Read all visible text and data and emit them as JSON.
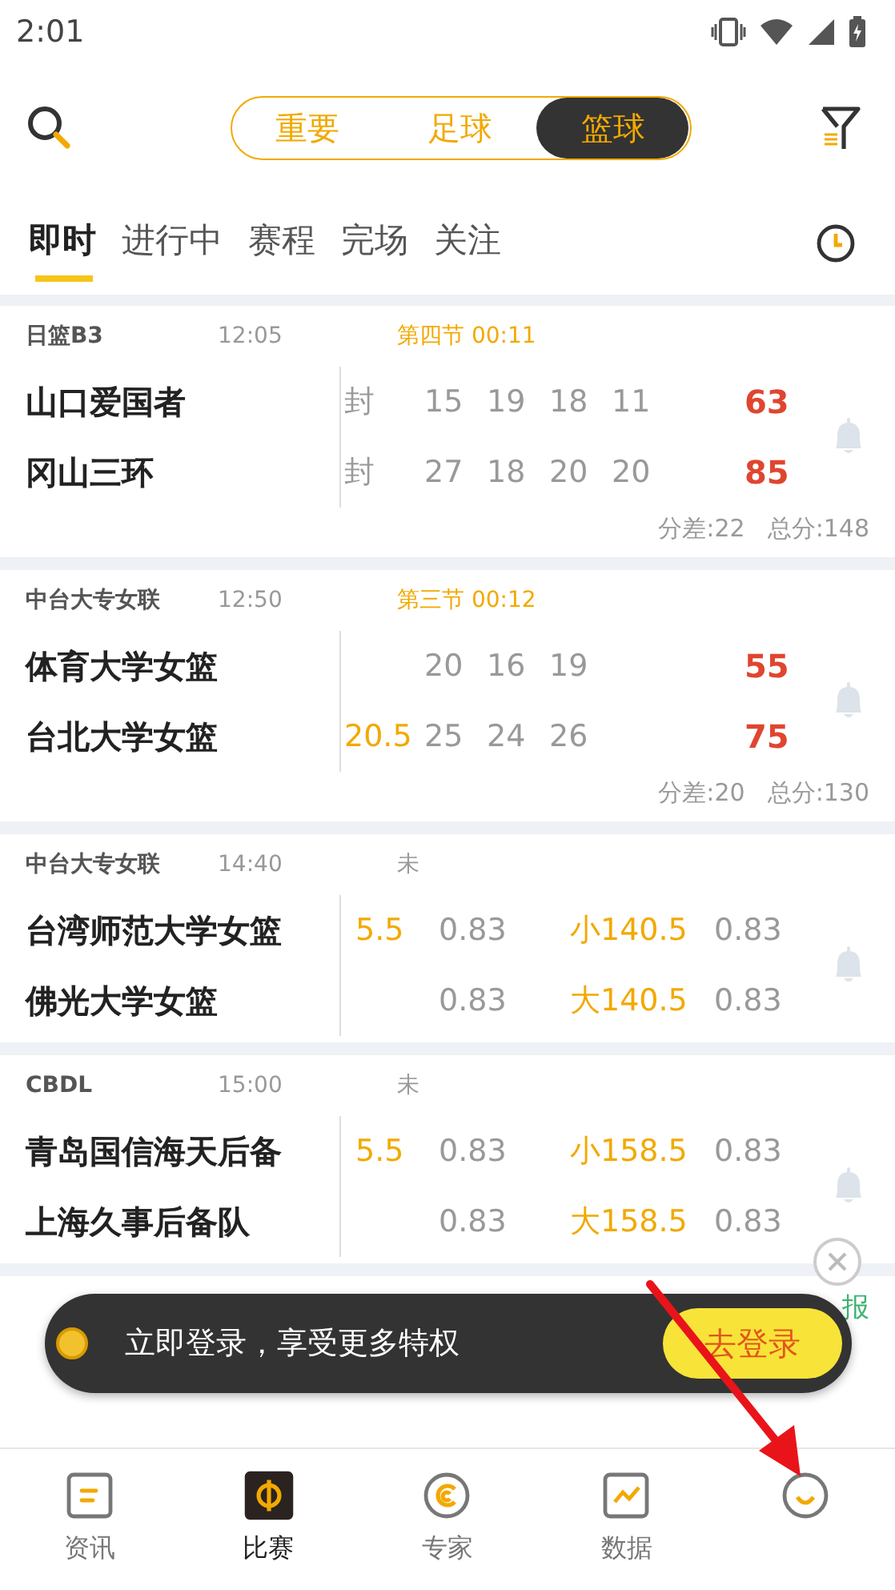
{
  "status_bar": {
    "time": "2:01"
  },
  "sport_tabs": [
    {
      "label": "重要",
      "selected": false
    },
    {
      "label": "足球",
      "selected": false
    },
    {
      "label": "篮球",
      "selected": true
    }
  ],
  "view_tabs": [
    {
      "label": "即时",
      "selected": true
    },
    {
      "label": "进行中",
      "selected": false
    },
    {
      "label": "赛程",
      "selected": false
    },
    {
      "label": "完场",
      "selected": false
    },
    {
      "label": "关注",
      "selected": false
    }
  ],
  "matches": [
    {
      "kind": "live",
      "league": "日篮B3",
      "time": "12:05",
      "status": "第四节 00:11",
      "teams": [
        {
          "name": "山口爱国者",
          "total": "63",
          "cells": [
            {
              "kind": "plain",
              "text": "封"
            },
            {
              "kind": "plain",
              "text": "15"
            },
            {
              "kind": "plain",
              "text": "19"
            },
            {
              "kind": "plain",
              "text": "18"
            },
            {
              "kind": "plain",
              "text": "11"
            }
          ]
        },
        {
          "name": "冈山三环",
          "total": "85",
          "cells": [
            {
              "kind": "plain",
              "text": "封"
            },
            {
              "kind": "plain",
              "text": "27"
            },
            {
              "kind": "plain",
              "text": "18"
            },
            {
              "kind": "plain",
              "text": "20"
            },
            {
              "kind": "plain",
              "text": "20"
            }
          ]
        }
      ],
      "footer": [
        "分差:22",
        "总分:148"
      ]
    },
    {
      "kind": "live",
      "league": "中台大专女联",
      "time": "12:50",
      "status": "第三节 00:12",
      "teams": [
        {
          "name": "体育大学女篮",
          "total": "55",
          "cells": [
            {
              "kind": "blank"
            },
            {
              "kind": "plain",
              "text": "20"
            },
            {
              "kind": "plain",
              "text": "16"
            },
            {
              "kind": "plain",
              "text": "19"
            }
          ]
        },
        {
          "name": "台北大学女篮",
          "total": "75",
          "cells": [
            {
              "kind": "line",
              "text": "20.5"
            },
            {
              "kind": "plain",
              "text": "25"
            },
            {
              "kind": "plain",
              "text": "24"
            },
            {
              "kind": "plain",
              "text": "26"
            }
          ]
        }
      ],
      "footer": [
        "分差:20",
        "总分:130"
      ]
    },
    {
      "kind": "odds",
      "league": "中台大专女联",
      "time": "14:40",
      "status": "未",
      "teams": [
        {
          "name": "台湾师范大学女篮",
          "cells": [
            {
              "kind": "line",
              "text": "5.5"
            },
            {
              "kind": "plain",
              "text": "0.83"
            },
            {
              "kind": "line",
              "text": "小140.5"
            },
            {
              "kind": "plain",
              "text": "0.83"
            }
          ]
        },
        {
          "name": "佛光大学女篮",
          "cells": [
            {
              "kind": "blank"
            },
            {
              "kind": "plain",
              "text": "0.83"
            },
            {
              "kind": "line",
              "text": "大140.5"
            },
            {
              "kind": "plain",
              "text": "0.83"
            }
          ]
        }
      ]
    },
    {
      "kind": "odds",
      "league": "CBDL",
      "time": "15:00",
      "status": "未",
      "teams": [
        {
          "name": "青岛国信海天后备",
          "cells": [
            {
              "kind": "line",
              "text": "5.5"
            },
            {
              "kind": "plain",
              "text": "0.83"
            },
            {
              "kind": "line",
              "text": "小158.5"
            },
            {
              "kind": "plain",
              "text": "0.83"
            }
          ]
        },
        {
          "name": "上海久事后备队",
          "cells": [
            {
              "kind": "blank"
            },
            {
              "kind": "plain",
              "text": "0.83"
            },
            {
              "kind": "line",
              "text": "大158.5"
            },
            {
              "kind": "plain",
              "text": "0.83"
            }
          ]
        }
      ]
    }
  ],
  "partial_match": {
    "tag": "报"
  },
  "login_toast": {
    "message": "立即登录，享受更多特权",
    "button": "去登录"
  },
  "nav": [
    {
      "kind": "news",
      "label": "资讯",
      "selected": false
    },
    {
      "kind": "match",
      "label": "比赛",
      "selected": true
    },
    {
      "kind": "expert",
      "label": "专家",
      "selected": false
    },
    {
      "kind": "data",
      "label": "数据",
      "selected": false
    },
    {
      "kind": "profile",
      "selected": false
    }
  ]
}
